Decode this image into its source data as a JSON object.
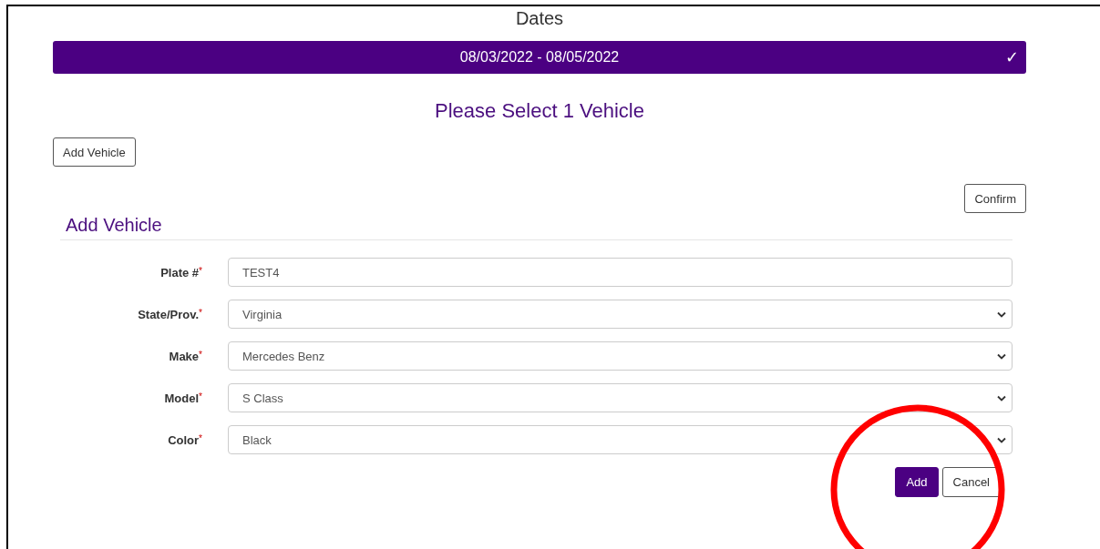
{
  "dates": {
    "title": "Dates",
    "range": "08/03/2022 - 08/05/2022",
    "check": "✓"
  },
  "heading": "Please Select 1 Vehicle",
  "add_vehicle_button": "Add Vehicle",
  "confirm_button": "Confirm",
  "form": {
    "title": "Add Vehicle",
    "fields": [
      {
        "label": "Plate #",
        "required_mark": "*",
        "kind": "input",
        "value": "TEST4"
      },
      {
        "label": "State/Prov.",
        "required_mark": "*",
        "kind": "select",
        "value": "Virginia"
      },
      {
        "label": "Make",
        "required_mark": "*",
        "kind": "select",
        "value": "Mercedes Benz"
      },
      {
        "label": "Model",
        "required_mark": "*",
        "kind": "select",
        "value": "S Class"
      },
      {
        "label": "Color",
        "required_mark": "*",
        "kind": "select",
        "value": "Black"
      }
    ],
    "buttons": [
      {
        "label": "Add",
        "kind": "primary"
      },
      {
        "label": "Cancel",
        "kind": "secondary"
      }
    ]
  },
  "annotation": {
    "kind": "circle"
  }
}
